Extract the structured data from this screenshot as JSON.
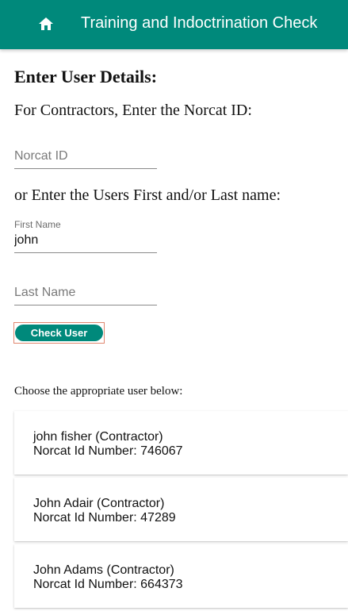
{
  "header": {
    "title": "Training and Indoctrination Check",
    "home_icon": "home-icon",
    "color": "#00897b"
  },
  "form": {
    "heading": "Enter User Details:",
    "contractor_prompt": "For Contractors, Enter the Norcat ID:",
    "norcat_placeholder": "Norcat ID",
    "norcat_value": "",
    "name_prompt": "or Enter the Users First and/or Last name:",
    "first_name_label": "First Name",
    "first_name_value": "john",
    "last_name_placeholder": "Last Name",
    "last_name_value": "",
    "check_button": "Check User"
  },
  "results": {
    "label": "Choose the appropriate user below:",
    "users": [
      {
        "name": "john fisher (Contractor)",
        "id_line": "Norcat Id Number: 746067"
      },
      {
        "name": "John Adair (Contractor)",
        "id_line": "Norcat Id Number: 47289"
      },
      {
        "name": "John Adams (Contractor)",
        "id_line": "Norcat Id Number: 664373"
      }
    ]
  }
}
